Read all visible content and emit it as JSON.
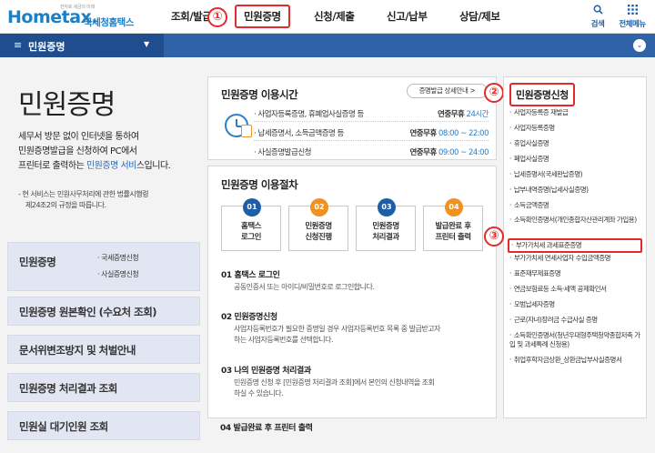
{
  "header": {
    "logo_small": "전자로 세금의 미래",
    "logo_main": "Hometax.",
    "logo_sub": "국세청홈택스",
    "nav": [
      {
        "label": "조회/발급"
      },
      {
        "label": "민원증명"
      },
      {
        "label": "신청/제출"
      },
      {
        "label": "신고/납부"
      },
      {
        "label": "상담/제보"
      }
    ],
    "search_label": "검색",
    "menu_label": "전체메뉴"
  },
  "subbar": {
    "title": "민원증명"
  },
  "markers": [
    "①",
    "②",
    "③"
  ],
  "left": {
    "page_title": "민원증명",
    "desc_1": "세무서 방문 없이 인터넷을 통하여",
    "desc_2": "민원증명발급을 신청하여 PC에서",
    "desc_3a": "프린터로 출력하는 ",
    "desc_3b": "민원증명 서비",
    "desc_3c": "스입니다.",
    "note_1": "- 현 서비스는 민원사무처리에 관한 법률시행령",
    "note_2": "제24조2의 규정을 따릅니다.",
    "box1_title": "민원증명",
    "box1_sub1": "· 국세증명신청",
    "box1_sub2": "· 사실증명신청",
    "box2": "민원증명 원본확인 (수요처 조회)",
    "box3": "문서위변조방지 및 처벌안내",
    "box4": "민원증명 처리결과 조회",
    "box5": "민원실 대기인원 조회"
  },
  "hours": {
    "title": "민원증명 이용시간",
    "detail_button": "증명발급 상세안내   >",
    "rows": [
      {
        "label": "· 사업자등록증명, 휴폐업사실증명 등",
        "days": "연중무휴",
        "time": "24시간"
      },
      {
        "label": "· 납세증명서, 소득금액증명 등",
        "days": "연중무휴",
        "time": "08:00 ~ 22:00"
      },
      {
        "label": "· 사실증명발급신청",
        "days": "연중무휴",
        "time": "09:00 ~ 24:00"
      }
    ]
  },
  "procedure": {
    "title": "민원증명 이용절차",
    "steps": [
      {
        "num": "01",
        "line1": "홈택스",
        "line2": "로그인",
        "color": "#1d5fa6"
      },
      {
        "num": "02",
        "line1": "민원증명",
        "line2": "신청진행",
        "color": "#f09221"
      },
      {
        "num": "03",
        "line1": "민원증명",
        "line2": "처리결과",
        "color": "#1d5fa6"
      },
      {
        "num": "04",
        "line1": "발급완료 후",
        "line2": "프린터 출력",
        "color": "#f09221"
      }
    ],
    "sections": [
      {
        "head": "01 홈택스 로그인",
        "p1": "공동인증서 또는 아이디/비밀번호로 로그인합니다.",
        "p2": ""
      },
      {
        "head": "02 민원증명신청",
        "p1": "사업자등록번호가 필요한 증명일 경우 사업자등록번호 목록 중 발급받고자",
        "p2": "하는 사업자등록번호를 선택합니다."
      },
      {
        "head": "03 나의 민원증명 처리결과",
        "p1": "민원증명 신청 후 [민원증명 처리결과 조회]에서 본인의 신청내역을 조회",
        "p2": "하실 수 있습니다."
      },
      {
        "head": "04 발급완료 후 프린터 출력",
        "p1": "",
        "p2": ""
      }
    ]
  },
  "apply": {
    "title": "민원증명신청",
    "items": [
      "사업자등록증 재발급",
      "사업자등록증명",
      "휴업사실증명",
      "폐업사실증명",
      "납세증명서(국세완납증명)",
      "납부내역증명(납세사실증명)",
      "소득금액증명",
      "소득확인증명서(개인종합자산관리계좌 가입용)",
      "부가가치세 과세표준증명",
      "부가가치세 면세사업자 수입금액증명",
      "표준재무제표증명",
      "연금보험료등 소득·세액 공제확인서",
      "모범납세자증명",
      "근로(자녀)장려금 수급사실 증명",
      "소득확인증명서(청년우대형주택청약종합저축 가입 및 과세특례 신청용)",
      "취업후학자금상환_상환금납부사실증명서"
    ]
  },
  "colors": {
    "accent": "#1d5fa6",
    "highlight": "#e12b2b",
    "orange": "#f09221"
  }
}
